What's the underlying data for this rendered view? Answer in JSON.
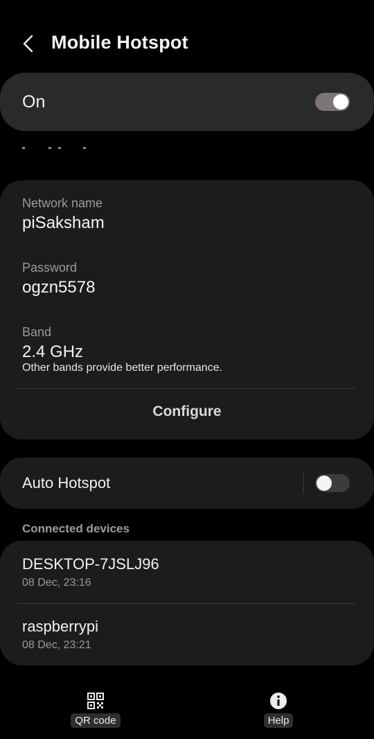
{
  "header": {
    "title": "Mobile Hotspot"
  },
  "master": {
    "label": "On",
    "enabled": true
  },
  "network": {
    "name_label": "Network name",
    "name_value": "piSaksham",
    "password_label": "Password",
    "password_value": "ogzn5578",
    "band_label": "Band",
    "band_value": "2.4 GHz",
    "band_hint": "Other bands provide better performance.",
    "configure_label": "Configure"
  },
  "auto_hotspot": {
    "label": "Auto Hotspot",
    "enabled": false
  },
  "connected": {
    "header": "Connected devices",
    "devices": [
      {
        "name": "DESKTOP-7JSLJ96",
        "time": "08 Dec, 23:16"
      },
      {
        "name": "raspberrypi",
        "time": "08 Dec, 23:21"
      }
    ]
  },
  "bottom_bar": {
    "qr_label": "QR code",
    "help_label": "Help"
  },
  "icons": {
    "back": "chevron-left-icon",
    "qr": "qr-code-icon",
    "help": "info-circle-icon"
  },
  "colors": {
    "background": "#000000",
    "card": "#1c1c1c",
    "toggle_on": "#7c7478"
  }
}
